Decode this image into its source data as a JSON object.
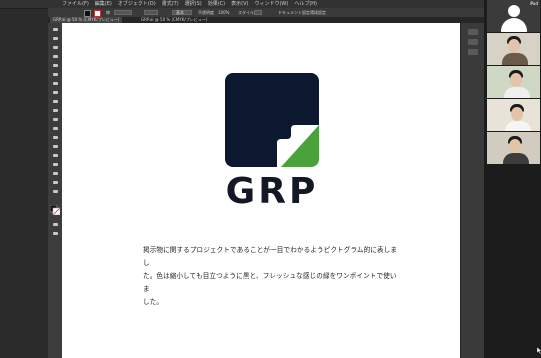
{
  "app": {
    "apple_glyph": "",
    "menus": [
      "ファイル(F)",
      "編集(E)",
      "オブジェクト(O)",
      "書式(T)",
      "選択(S)",
      "効果(C)",
      "表示(V)",
      "ウィンドウ(W)",
      "ヘルプ(H)"
    ]
  },
  "control_bar": {
    "stroke_label": "線",
    "width_value": "1 pt",
    "style_label": "スタイル",
    "document_setup": "ドキュメント設定",
    "preferences": "環境設定",
    "profile_label": "基本",
    "opacity_label": "不透明度",
    "opacity_value": "100%"
  },
  "tabs": [
    {
      "label": "GRP.ai @ 50 % (CMYK/プレビュー)",
      "active": true
    },
    {
      "label": "GRP.ai @ 50 % (CMYK/プレビュー)",
      "active": false
    }
  ],
  "artboard": {
    "logo_text": "GRP",
    "logo_colors": {
      "navy": "#0c1730",
      "green": "#4aa33a",
      "white": "#ffffff"
    },
    "description": [
      "掲示物に関するプロジェクトであることが一目でわかるようピクトグラム的に表しまし",
      "た。色は縮小しても目立つように黒と、フレッシュな感じの緑をワンポイントで使いま",
      "した。"
    ]
  },
  "zoom": {
    "tiles": [
      {
        "type": "avatar",
        "name": "iPad"
      },
      {
        "type": "person",
        "caption": ""
      },
      {
        "type": "person",
        "caption": ""
      },
      {
        "type": "person",
        "caption": ""
      },
      {
        "type": "person",
        "caption": ""
      }
    ]
  },
  "colors": {
    "app_chrome": "#323232",
    "tool_panel": "#3c3c3c",
    "artboard_bg": "#ffffff",
    "zoom_bg": "#1c1c1c"
  }
}
